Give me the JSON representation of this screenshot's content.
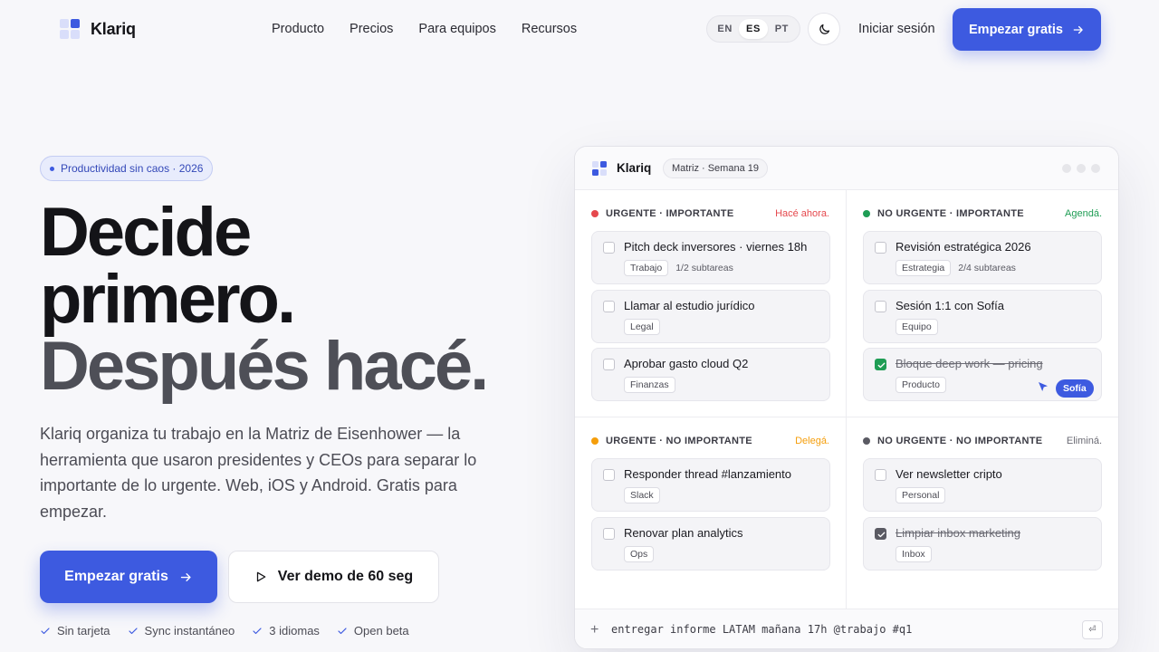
{
  "brand": {
    "name": "Klariq"
  },
  "nav": {
    "links": [
      "Producto",
      "Precios",
      "Para equipos",
      "Recursos"
    ],
    "languages": [
      "EN",
      "ES",
      "PT"
    ],
    "active_language": "ES",
    "login": "Iniciar sesión",
    "cta": "Empezar gratis"
  },
  "hero": {
    "badge": "Productividad sin caos · 2026",
    "headline": [
      "Decide",
      "primero.",
      "Después hacé."
    ],
    "lede": "Klariq organiza tu trabajo en la Matriz de Eisenhower — la herramienta que usaron presidentes y CEOs para separar lo importante de lo urgente. Web, iOS y Android. Gratis para empezar.",
    "cta_primary": "Empezar gratis",
    "cta_secondary": "Ver demo de 60 seg",
    "perks": [
      "Sin tarjeta",
      "Sync instantáneo",
      "3 idiomas",
      "Open beta"
    ]
  },
  "app": {
    "name": "Klariq",
    "view_label": "Matriz · Semana 19",
    "quadrants": [
      {
        "title": "URGENTE · IMPORTANTE",
        "action": "Hacé ahora.",
        "color": "#e5484d",
        "action_color": "#e5484d",
        "tasks": [
          {
            "title": "Pitch deck inversores · viernes 18h",
            "tag": "Trabajo",
            "sub": "1/2 subtareas",
            "done": false
          },
          {
            "title": "Llamar al estudio jurídico",
            "tag": "Legal",
            "sub": "",
            "done": false
          },
          {
            "title": "Aprobar gasto cloud Q2",
            "tag": "Finanzas",
            "sub": "",
            "done": false
          }
        ]
      },
      {
        "title": "NO URGENTE · IMPORTANTE",
        "action": "Agendá.",
        "color": "#1f9d55",
        "action_color": "#1f9d55",
        "tasks": [
          {
            "title": "Revisión estratégica 2026",
            "tag": "Estrategia",
            "sub": "2/4 subtareas",
            "done": false
          },
          {
            "title": "Sesión 1:1 con Sofía",
            "tag": "Equipo",
            "sub": "",
            "done": false
          },
          {
            "title": "Bloque deep work — pricing",
            "tag": "Producto",
            "sub": "",
            "done": true,
            "collaborator": "Sofía"
          }
        ]
      },
      {
        "title": "URGENTE · NO IMPORTANTE",
        "action": "Delegá.",
        "color": "#f59e0b",
        "action_color": "#f59e0b",
        "tasks": [
          {
            "title": "Responder thread #lanzamiento",
            "tag": "Slack",
            "sub": "",
            "done": false
          },
          {
            "title": "Renovar plan analytics",
            "tag": "Ops",
            "sub": "",
            "done": false
          }
        ]
      },
      {
        "title": "NO URGENTE · NO IMPORTANTE",
        "action": "Eliminá.",
        "color": "#5a5a63",
        "action_color": "#6b6b74",
        "tasks": [
          {
            "title": "Ver newsletter cripto",
            "tag": "Personal",
            "sub": "",
            "done": false
          },
          {
            "title": "Limpiar inbox marketing",
            "tag": "Inbox",
            "sub": "",
            "done": true
          }
        ]
      }
    ],
    "quick_add": "entregar informe LATAM mañana 17h @trabajo #q1",
    "quick_add_key": "⏎"
  },
  "colors": {
    "accent": "#3d5ae0"
  }
}
